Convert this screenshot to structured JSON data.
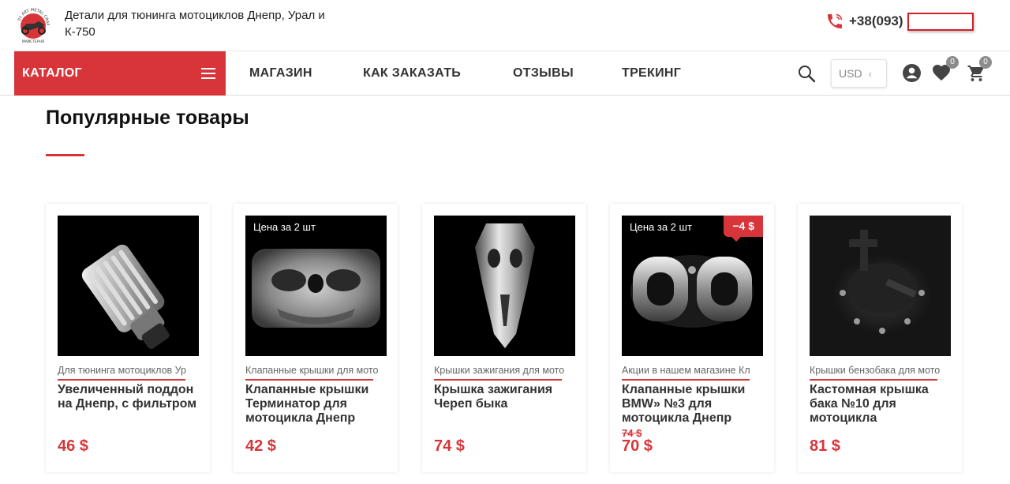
{
  "header": {
    "tagline": "Детали для тюнинга мотоциклов Днепр, Урал и К-750",
    "logo_text": "01 ART METAL CRAFT МАЙСТЕРНЯ",
    "phone": "+38(093)"
  },
  "nav": {
    "catalog_label": "КАТАЛОГ",
    "items": [
      "МАГАЗИН",
      "КАК ЗАКАЗАТЬ",
      "ОТЗЫВЫ",
      "ТРЕКИНГ"
    ],
    "currency": "USD",
    "wishlist_count": "0",
    "cart_count": "0",
    "icons": [
      "search-icon",
      "user-icon",
      "heart-icon",
      "cart-icon",
      "phone-icon",
      "menu-icon"
    ]
  },
  "section": {
    "title": "Популярные товары"
  },
  "products": [
    {
      "category": "Для тюнинга мотоциклов   Ур",
      "name": "Увеличенный поддон на Днепр, с фильтром",
      "price": "46 $",
      "tag": "",
      "discount": "",
      "old_price": ""
    },
    {
      "category": "Клапанные крышки для мото",
      "name": "Клапанные крышки Терминатор для мотоцикла Днепр",
      "price": "42 $",
      "tag": "Цена за 2 шт",
      "discount": "",
      "old_price": ""
    },
    {
      "category": "Крышки зажигания для мото",
      "name": "Крышка зажигания Череп быка",
      "price": "74 $",
      "tag": "",
      "discount": "",
      "old_price": ""
    },
    {
      "category": "Акции в нашем магазине   Кл",
      "name": "Клапанные крышки BMW» №3 для мотоцикла Днепр",
      "price": "70 $",
      "tag": "Цена за 2 шт",
      "discount": "−4 $",
      "old_price": "74 $"
    },
    {
      "category": "Крышки бензобака для мото",
      "name": "Кастомная крышка бака №10 для мотоцикла",
      "price": "81 $",
      "tag": "",
      "discount": "",
      "old_price": ""
    }
  ],
  "colors": {
    "accent": "#d7353a",
    "badge": "#8c8c8c",
    "text": "#333333"
  }
}
